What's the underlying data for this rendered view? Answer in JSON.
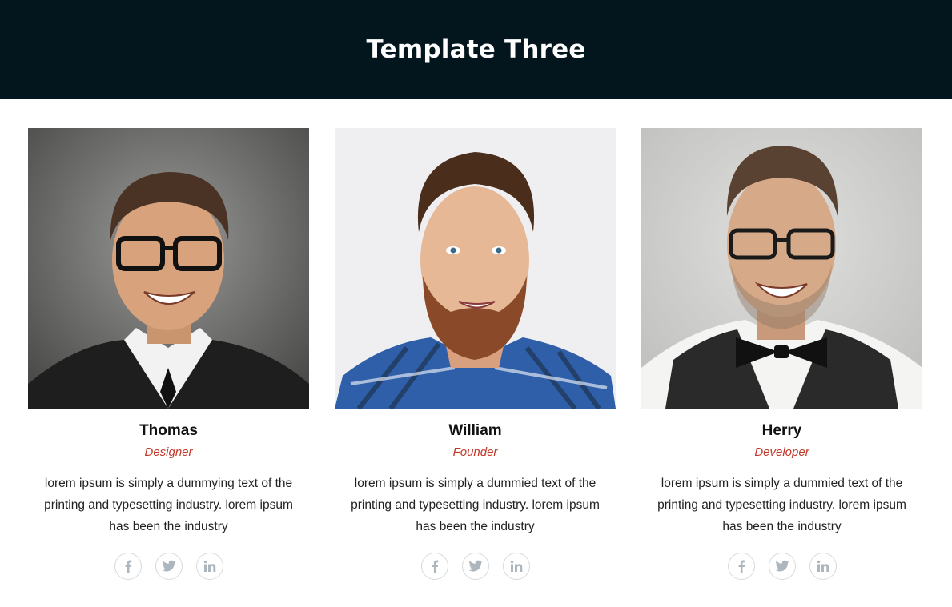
{
  "header": {
    "title": "Template Three"
  },
  "team": [
    {
      "name": "Thomas",
      "role": "Designer",
      "description": "lorem ipsum is simply a dummying text of the printing and typesetting industry. lorem ipsum has been the industry"
    },
    {
      "name": "William",
      "role": "Founder",
      "description": "lorem ipsum is simply a dummied text of the printing and typesetting industry. lorem ipsum has been the industry"
    },
    {
      "name": "Herry",
      "role": "Developer",
      "description": "lorem ipsum is simply a dummied text of the printing and typesetting industry. lorem ipsum has been the industry"
    }
  ],
  "social_icons": [
    "facebook-icon",
    "twitter-icon",
    "linkedin-icon"
  ],
  "colors": {
    "header_bg": "#03151d",
    "role_text": "#c0392b",
    "icon_gray": "#aeb6bd"
  }
}
